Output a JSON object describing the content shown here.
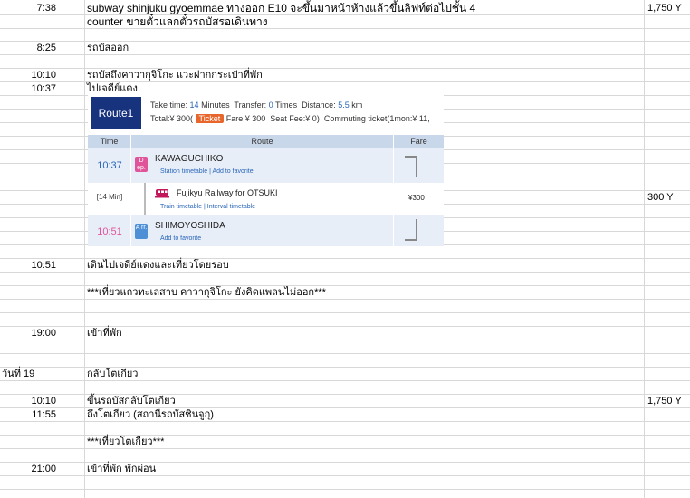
{
  "rows": [
    {
      "time": "7:38",
      "desc": "subway shinjuku gyoemmae ทางออก E10 จะขึ้นมาหน้าห้างแล้วขึ้นลิฟท์ต่อไปชั้น 4",
      "price": "1,750 Y"
    },
    {
      "time": "",
      "desc": "counter ขายตั๋วแลกตั๋วรถบัสรอเดินทาง",
      "price": ""
    },
    {
      "time": "8:25",
      "desc": "รถบัสออก",
      "price": ""
    },
    {
      "time": "10:10",
      "desc": "รถบัสถึงคาวากุจิโกะ แวะฝากกระเป๋าที่พัก",
      "price": ""
    },
    {
      "time": "10:37",
      "desc": "ไปเจดีย์แดง",
      "price": ""
    },
    {
      "time": "",
      "desc": "",
      "price": "300 Y"
    },
    {
      "time": "10:51",
      "desc": "เดินไปเจดีย์แดงและเที่ยวโดยรอบ",
      "price": ""
    },
    {
      "time": "",
      "desc": "***เที่ยวแถวทะเลสาบ คาวากุจิโกะ ยังคิดแพลนไม่ออก***",
      "price": ""
    },
    {
      "time": "19:00",
      "desc": "เข้าที่พัก",
      "price": ""
    },
    {
      "time": "วันที่ 19",
      "desc": "กลับโตเกียว",
      "price": ""
    },
    {
      "time": "10:10",
      "desc": "ขึ้นรถบัสกลับโตเกียว",
      "price": "1,750 Y"
    },
    {
      "time": "11:55",
      "desc": "ถึงโตเกียว (สถานีรถบัสชินจูกุ)",
      "price": ""
    },
    {
      "time": "",
      "desc": "***เที่ยวโตเกียว***",
      "price": ""
    },
    {
      "time": "21:00",
      "desc": "เข้าที่พัก พักผ่อน",
      "price": ""
    }
  ],
  "route": {
    "badge": "Route1",
    "take_time_label": "Take time:",
    "take_time_value": "14",
    "minutes_label": "Minutes",
    "transfer_label": "Transfer:",
    "transfer_value": "0",
    "times_label": "Times",
    "distance_label": "Distance:",
    "distance_value": "5.5",
    "km_label": "km",
    "total_label": "Total:¥ 300(",
    "ticket_label": "Ticket",
    "fare_label": "Fare:¥ 300",
    "seat_label": "Seat Fee:¥ 0)",
    "commute_label": "Commuting ticket(1mon:¥ 11,",
    "col_time": "Time",
    "col_route": "Route",
    "col_fare": "Fare",
    "dep_time": "10:37",
    "dep_badge": "D ep.",
    "dep_station": "KAWAGUCHIKO",
    "dep_links": "Station timetable | Add to favorite",
    "duration": "[14 Min]",
    "line_name": "Fujikyu Railway  for OTSUKI",
    "line_links": "Train timetable | Interval timetable",
    "segment_fare": "¥300",
    "arr_time": "10:51",
    "arr_badge": "A rr.",
    "arr_station": "SHIMOYOSHIDA",
    "arr_links": "Add to favorite",
    "colors": {
      "navy": "#17337e",
      "blue": "#2a66b8",
      "ticket": "#e8652b",
      "dep": "#e0559a",
      "arr": "#4e8fd6",
      "train": "#c2185b"
    }
  }
}
